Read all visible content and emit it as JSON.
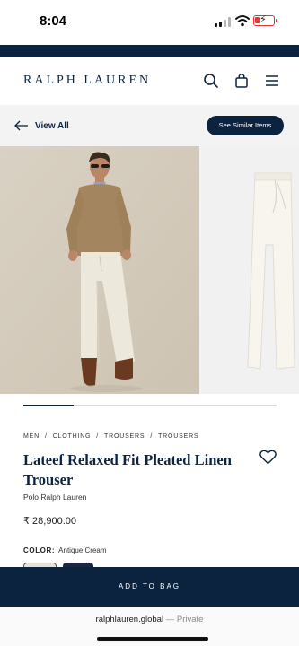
{
  "status_bar": {
    "time": "8:04"
  },
  "header": {
    "logo": "RALPH LAUREN"
  },
  "subnav": {
    "back_label": "View All",
    "similar_label": "See Similar Items"
  },
  "gallery": {
    "current_slide": 1,
    "total_slides": 5
  },
  "product": {
    "breadcrumb": [
      "MEN",
      "/",
      "CLOTHING",
      "/",
      "TROUSERS",
      "/",
      "TROUSERS"
    ],
    "title": "Lateef Relaxed Fit Pleated Linen Trouser",
    "brand": "Polo Ralph Lauren",
    "price": "₹ 28,900.00",
    "color_label": "COLOR:",
    "color_value": "Antique Cream",
    "swatch_colors": [
      "#e6e2d8",
      "#1d2744"
    ]
  },
  "add_to_bag": {
    "label": "ADD TO BAG"
  },
  "browser": {
    "url": "ralphlauren.global",
    "private_label": " — Private"
  },
  "colors": {
    "navy": "#0c2340",
    "battery": "#e23a3a"
  },
  "icons": [
    "search-icon",
    "shopping-bag-icon",
    "menu-icon",
    "back-arrow-icon",
    "heart-icon",
    "wifi-icon",
    "battery-icon",
    "signal-icon"
  ]
}
